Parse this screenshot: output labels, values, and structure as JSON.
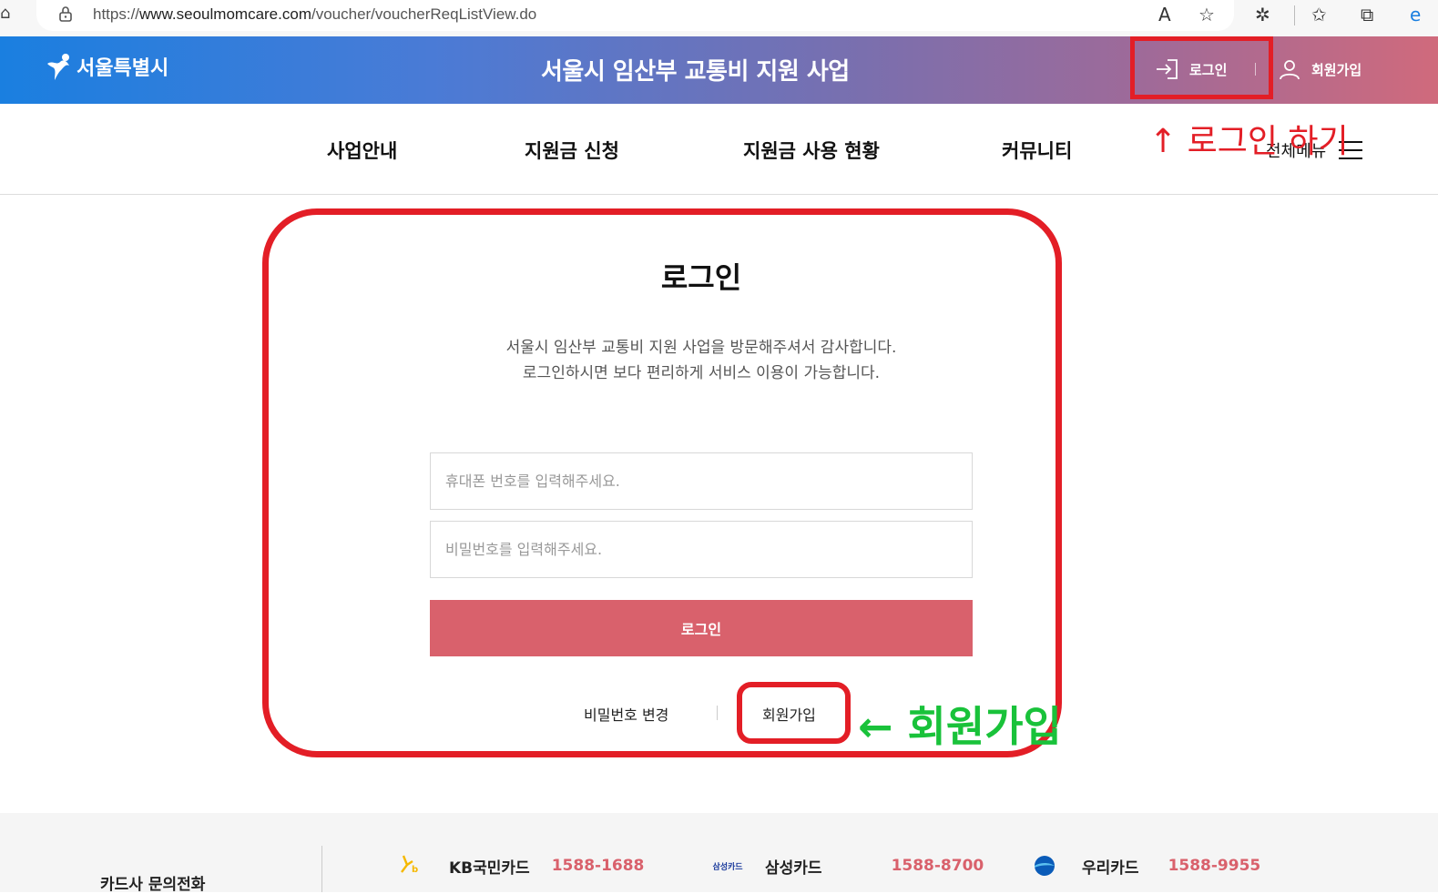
{
  "browser": {
    "url_prefix": "https://",
    "url_host": "www.seoulmomcare.com",
    "url_path": "/voucher/voucherReqListView.do",
    "icons": [
      "home-icon",
      "lock-icon",
      "read-aloud-icon",
      "favorite-add-icon",
      "extensions-icon",
      "favorites-icon",
      "collections-icon",
      "edge-icon"
    ]
  },
  "header": {
    "logo_text": "서울특별시",
    "site_title": "서울시 임산부 교통비 지원 사업",
    "login_label": "로그인",
    "join_label": "회원가입"
  },
  "nav": {
    "items": [
      "사업안내",
      "지원금 신청",
      "지원금 사용 현황",
      "커뮤니티"
    ],
    "all_menu": "전체메뉴"
  },
  "annotations": {
    "login_hint": "↑ 로그인 하기",
    "join_hint": "← 회원가입",
    "color_red": "#e31e26",
    "color_green": "#19c23a"
  },
  "login": {
    "title": "로그인",
    "intro_line1": "서울시 임산부 교통비 지원 사업을 방문해주셔서 감사합니다.",
    "intro_line2": "로그인하시면 보다 편리하게 서비스 이용이 가능합니다.",
    "phone_placeholder": "휴대폰 번호를 입력해주세요.",
    "password_placeholder": "비밀번호를 입력해주세요.",
    "submit_label": "로그인",
    "change_password": "비밀번호 변경",
    "join": "회원가입",
    "button_color": "#d9616c"
  },
  "footer": {
    "title": "카드사 문의전화",
    "cards": [
      {
        "name": "KB국민카드",
        "tel": "1588-1688",
        "icon": "kb-card-icon"
      },
      {
        "name": "삼성카드",
        "tel": "1588-8700",
        "icon": "samsung-card-icon",
        "icon_text": "삼성카드"
      },
      {
        "name": "우리카드",
        "tel": "1588-9955",
        "icon": "woori-card-icon"
      }
    ]
  }
}
